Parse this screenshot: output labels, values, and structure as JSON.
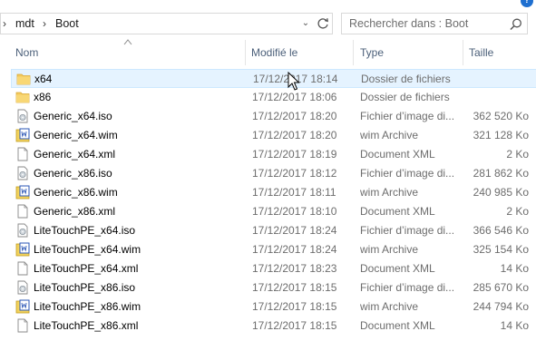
{
  "breadcrumb": {
    "items": [
      "mdt",
      "Boot"
    ],
    "separator": "›"
  },
  "search": {
    "placeholder": "Rechercher dans : Boot"
  },
  "help_icon": "?",
  "columns": {
    "name": "Nom",
    "modified": "Modifié le",
    "type": "Type",
    "size": "Taille"
  },
  "files": [
    {
      "name": "x64",
      "modified": "17/12/2017 18:14",
      "type": "Dossier de fichiers",
      "size": "",
      "icon": "folder-icon"
    },
    {
      "name": "x86",
      "modified": "17/12/2017 18:06",
      "type": "Dossier de fichiers",
      "size": "",
      "icon": "folder-icon"
    },
    {
      "name": "Generic_x64.iso",
      "modified": "17/12/2017 18:20",
      "type": "Fichier d’image di...",
      "size": "362 520 Ko",
      "icon": "disc-image-icon"
    },
    {
      "name": "Generic_x64.wim",
      "modified": "17/12/2017 18:20",
      "type": "wim Archive",
      "size": "321 128 Ko",
      "icon": "wim-archive-icon"
    },
    {
      "name": "Generic_x64.xml",
      "modified": "17/12/2017 18:19",
      "type": "Document XML",
      "size": "2 Ko",
      "icon": "document-icon"
    },
    {
      "name": "Generic_x86.iso",
      "modified": "17/12/2017 18:12",
      "type": "Fichier d’image di...",
      "size": "281 862 Ko",
      "icon": "disc-image-icon"
    },
    {
      "name": "Generic_x86.wim",
      "modified": "17/12/2017 18:11",
      "type": "wim Archive",
      "size": "240 985 Ko",
      "icon": "wim-archive-icon"
    },
    {
      "name": "Generic_x86.xml",
      "modified": "17/12/2017 18:10",
      "type": "Document XML",
      "size": "2 Ko",
      "icon": "document-icon"
    },
    {
      "name": "LiteTouchPE_x64.iso",
      "modified": "17/12/2017 18:24",
      "type": "Fichier d’image di...",
      "size": "366 546 Ko",
      "icon": "disc-image-icon"
    },
    {
      "name": "LiteTouchPE_x64.wim",
      "modified": "17/12/2017 18:24",
      "type": "wim Archive",
      "size": "325 154 Ko",
      "icon": "wim-archive-icon"
    },
    {
      "name": "LiteTouchPE_x64.xml",
      "modified": "17/12/2017 18:23",
      "type": "Document XML",
      "size": "14 Ko",
      "icon": "document-icon"
    },
    {
      "name": "LiteTouchPE_x86.iso",
      "modified": "17/12/2017 18:15",
      "type": "Fichier d’image di...",
      "size": "285 670 Ko",
      "icon": "disc-image-icon"
    },
    {
      "name": "LiteTouchPE_x86.wim",
      "modified": "17/12/2017 18:15",
      "type": "wim Archive",
      "size": "244 794 Ko",
      "icon": "wim-archive-icon"
    },
    {
      "name": "LiteTouchPE_x86.xml",
      "modified": "17/12/2017 18:15",
      "type": "Document XML",
      "size": "14 Ko",
      "icon": "document-icon"
    }
  ],
  "hovered_row": 0,
  "colors": {
    "hover_bg": "#e5f3ff",
    "hover_border": "#cce8ff",
    "folder": "#f3c95c",
    "header_text": "#4c607a",
    "secondary_text": "#6d6d6d"
  }
}
